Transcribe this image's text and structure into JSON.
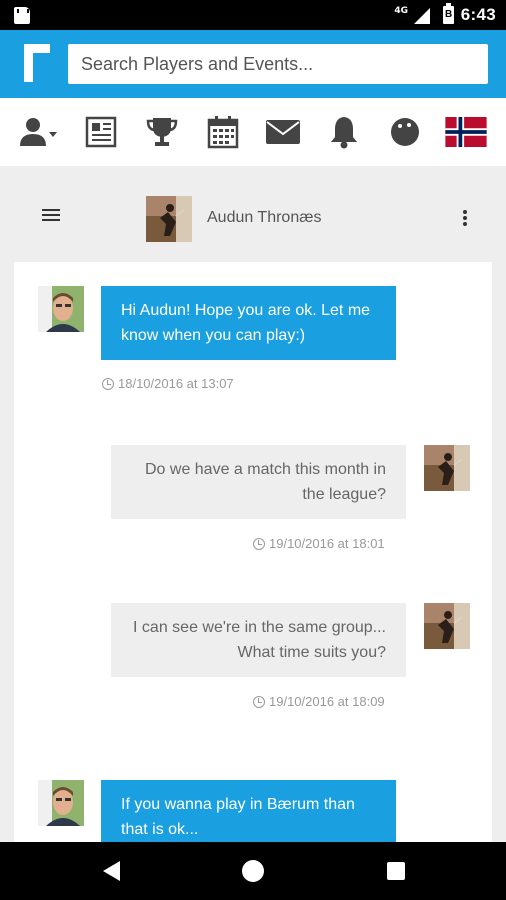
{
  "status_bar": {
    "network": "4G",
    "time": "6:43"
  },
  "header": {
    "search_placeholder": "Search Players and Events..."
  },
  "nav_icons": [
    "user-menu-icon",
    "news-icon",
    "trophy-icon",
    "calendar-icon",
    "mail-icon",
    "bell-icon",
    "ball-icon",
    "norway-flag-icon"
  ],
  "conversation": {
    "contact_name": "Audun Thronæs"
  },
  "messages": [
    {
      "direction": "outgoing",
      "text": "Hi Audun! Hope you are ok. Let me know when you can play:)",
      "timestamp": "18/10/2016 at 13:07"
    },
    {
      "direction": "incoming",
      "text": "Do we have a match this month in the league?",
      "timestamp": "19/10/2016 at 18:01"
    },
    {
      "direction": "incoming",
      "text": "I can see we're in the same group... What time suits you?",
      "timestamp": "19/10/2016 at 18:09"
    },
    {
      "direction": "outgoing",
      "text": "If you wanna play in Bærum than that is ok...",
      "timestamp": ""
    }
  ],
  "colors": {
    "brand_blue": "#1a9fe0",
    "incoming_bubble": "#eeeeee",
    "flag_red": "#ba0c2f",
    "flag_blue": "#00205b"
  }
}
